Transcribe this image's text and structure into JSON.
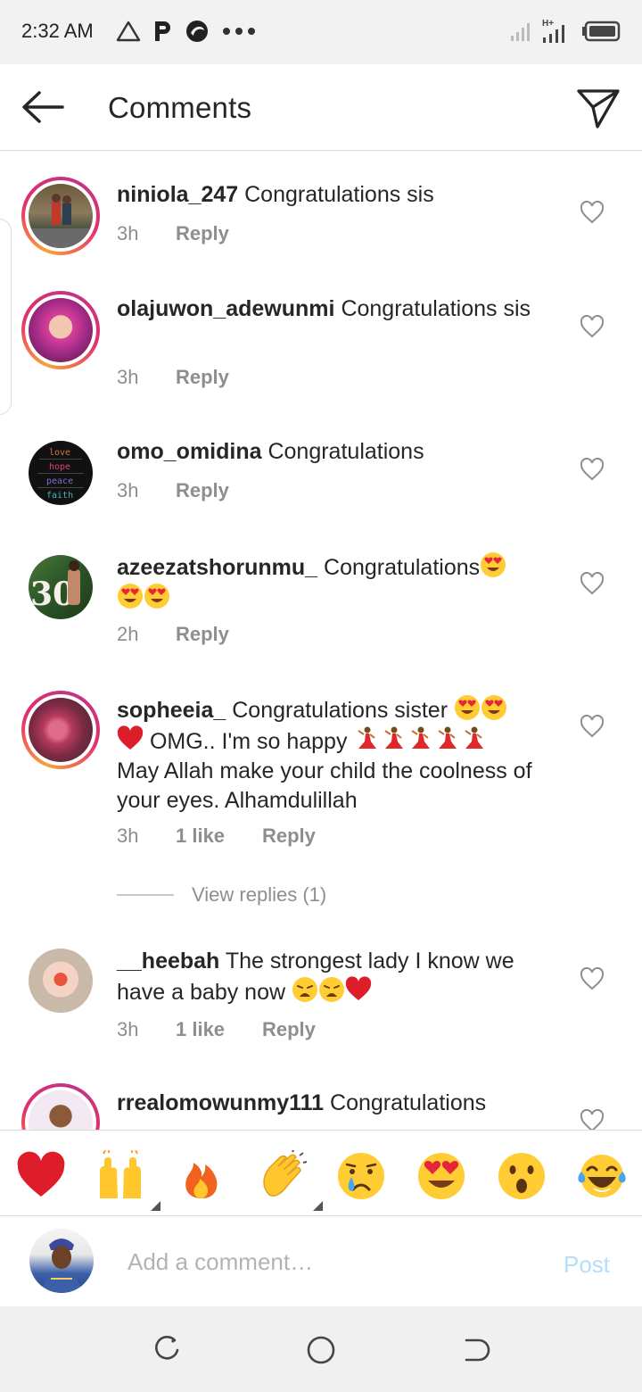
{
  "status_bar": {
    "time": "2:32 AM",
    "left_icons": [
      "warning-triangle-icon",
      "p-icon",
      "swirl-icon",
      "more-dots-icon"
    ],
    "right_icons": [
      "signal-icon",
      "signal-h-plus-icon",
      "battery-icon"
    ],
    "network_label": "H+"
  },
  "header": {
    "title": "Comments",
    "back_icon": "arrow-left-icon",
    "send_icon": "paper-plane-icon"
  },
  "comments": [
    {
      "username": "niniola_247",
      "text": "Congratulations sis",
      "time": "3h",
      "likes": "",
      "reply": "Reply"
    },
    {
      "username": "olajuwon_adewunmi",
      "text": "Congratulations sis",
      "time": "3h",
      "likes": "",
      "reply": "Reply"
    },
    {
      "username": "omo_omidina",
      "text": "Congratulations",
      "time": "3h",
      "likes": "",
      "reply": "Reply"
    },
    {
      "username": "azeezatshorunmu_",
      "text": "Congratulations",
      "time": "2h",
      "likes": "",
      "reply": "Reply"
    },
    {
      "username": "sopheeia_",
      "text": "Congratulations sister",
      "text2": "OMG.. I'm so happy",
      "text3": "May Allah make your child the coolness of your eyes. Alhamdulillah",
      "time": "3h",
      "likes": "1 like",
      "reply": "Reply"
    },
    {
      "username": "__heebah",
      "text": "The strongest lady I know we have a baby now",
      "time": "3h",
      "likes": "1 like",
      "reply": "Reply"
    },
    {
      "username": "rrealomowunmy111",
      "text": "Congratulations",
      "time": "",
      "likes": "",
      "reply": ""
    }
  ],
  "view_replies": "View replies (1)",
  "avatar_art": {
    "omo_omidina_words": [
      "love",
      "hope",
      "peace",
      "faith"
    ],
    "azeezat_number": "30"
  },
  "emoji_bar": [
    "red-heart",
    "raising-hands",
    "fire",
    "clapping-hands",
    "crying-face",
    "heart-eyes",
    "surprised-face",
    "tears-of-joy"
  ],
  "composer": {
    "placeholder": "Add a comment…",
    "post_label": "Post"
  },
  "nav_bar": [
    "recent-apps-icon",
    "home-icon",
    "back-icon"
  ],
  "colors": {
    "story_ring_start": "#f9a13a",
    "story_ring_end": "#c13584",
    "secondary_text": "#8e8e8e",
    "post_disabled": "#b2dffc",
    "heart_red": "#ed1c24"
  }
}
